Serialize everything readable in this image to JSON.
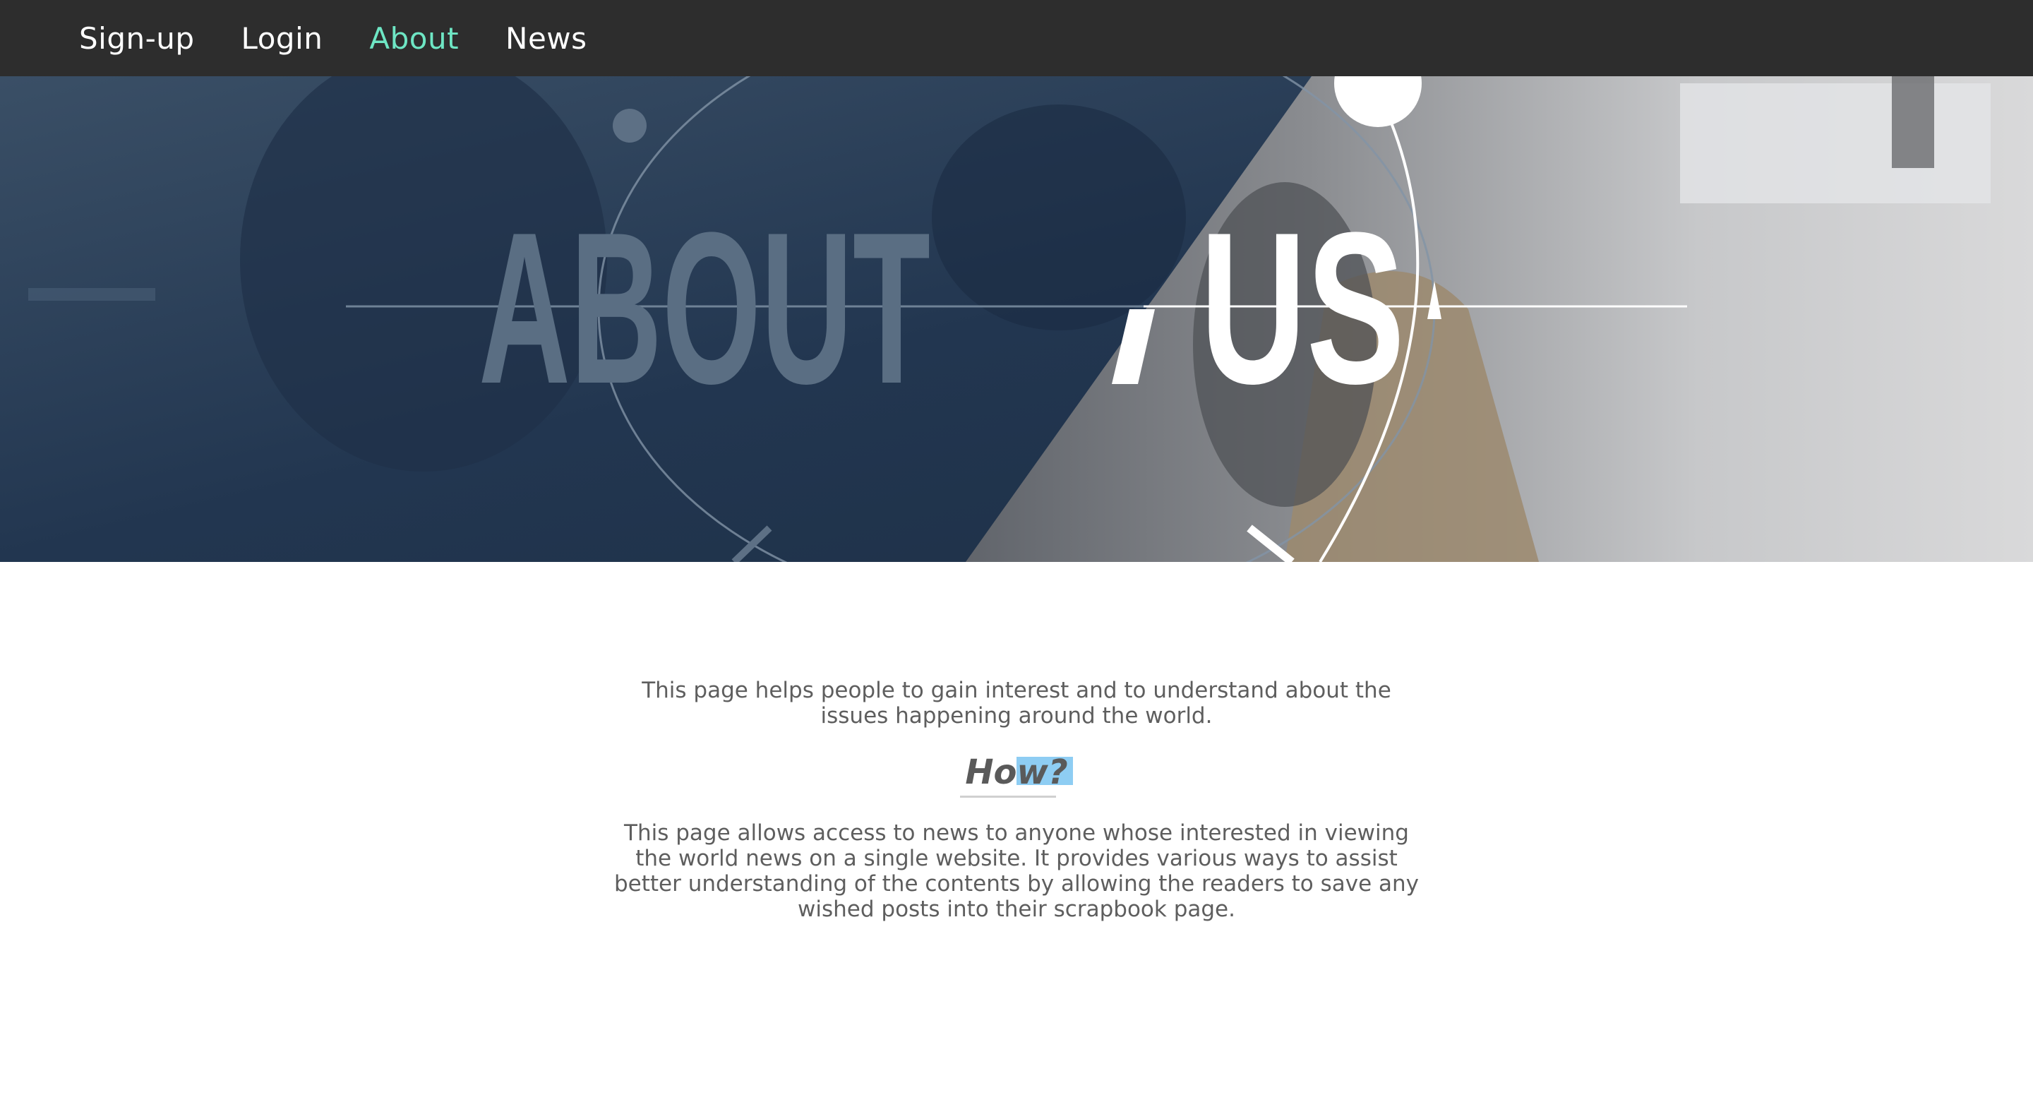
{
  "nav": {
    "items": [
      {
        "label": "Sign-up"
      },
      {
        "label": "Login"
      },
      {
        "label": "About"
      },
      {
        "label": "News"
      }
    ],
    "active_color": "#6ee6c4"
  },
  "hero": {
    "title_left": "ABOUT",
    "title_right": "US"
  },
  "main": {
    "intro": "This page helps people to gain interest and to understand about the issues happening around the world.",
    "heading": "How?",
    "details": "This page allows access to news to anyone whose interested in viewing the world news on a single website. It provides various ways to assist better understanding of the contents by allowing the readers to save any wished posts into their scrapbook page."
  }
}
